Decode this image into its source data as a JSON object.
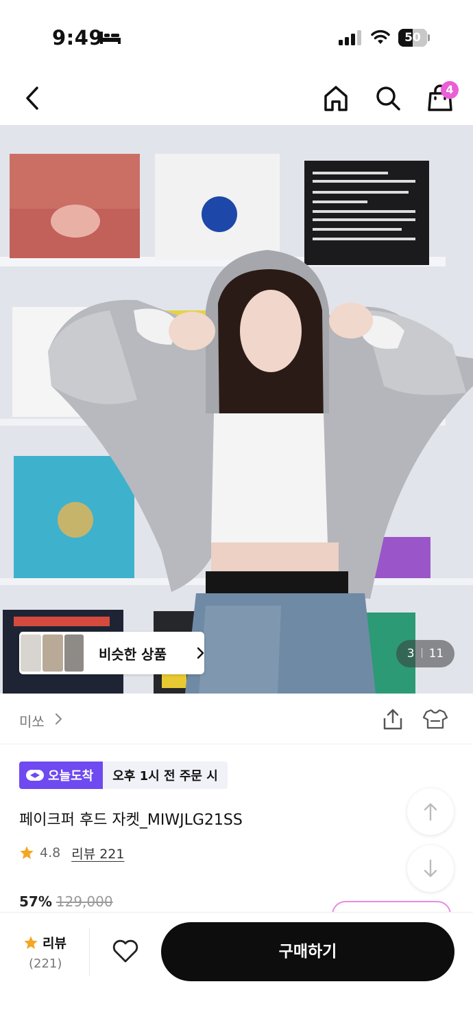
{
  "status_bar": {
    "time": "9:49",
    "battery_level": "50",
    "battery_fraction": 0.5,
    "icons": [
      "bed-icon",
      "signal-icon",
      "wifi-icon",
      "battery-icon"
    ]
  },
  "nav": {
    "icons": [
      "back-arrow-icon",
      "home-icon",
      "search-icon",
      "shopping-bag-icon"
    ],
    "cart_count": "4",
    "badge_color": "#ea5fd8"
  },
  "gallery": {
    "similar_label": "비슷한 상품",
    "current_index": "3",
    "total": "11"
  },
  "brand": {
    "name": "미쏘",
    "icons": [
      "share-icon",
      "fitting-icon"
    ]
  },
  "delivery": {
    "badge": "오늘도착",
    "note": "오후 1시 전 주문 시",
    "badge_color": "#6e4af0"
  },
  "product": {
    "title": "페이크퍼 후드 자켓_MIWJLG21SS",
    "rating": "4.8",
    "review_link": "리뷰 221",
    "discount": "57%",
    "original_price": "129,000"
  },
  "bottom_bar": {
    "review_label": "리뷰",
    "review_count": "(221)",
    "buy_label": "구매하기",
    "buy_color": "#0d0d0d",
    "star_color": "#f5a623"
  }
}
